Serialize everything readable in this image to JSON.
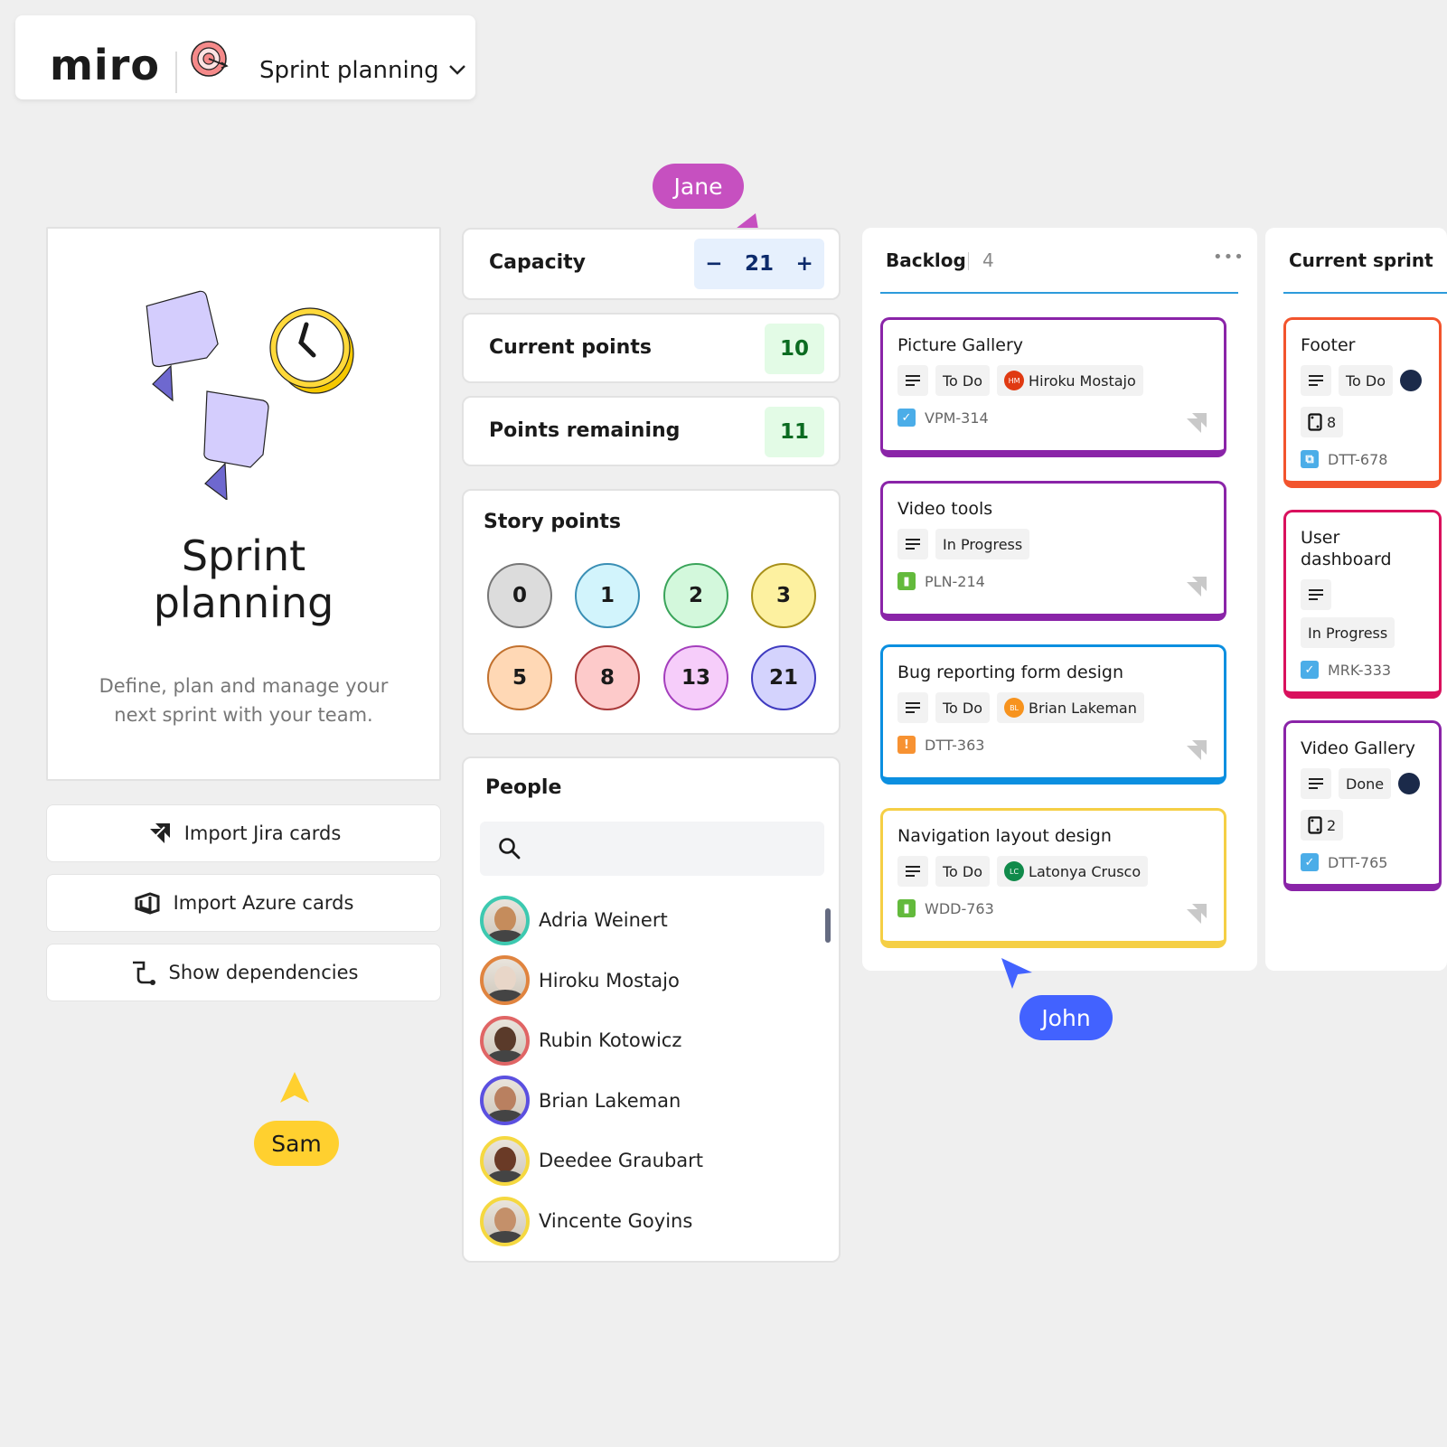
{
  "header": {
    "logo": "miro",
    "board_name": "Sprint planning",
    "board_icon": "target-icon",
    "dropdown_icon": "chevron-down-icon"
  },
  "cursors": [
    {
      "name": "Jane",
      "color": "#c650c0"
    },
    {
      "name": "Sam",
      "color": "#ffd02f"
    },
    {
      "name": "John",
      "color": "#4262ff"
    }
  ],
  "intro": {
    "title_line1": "Sprint",
    "title_line2": "planning",
    "desc_line1": "Define, plan and manage your",
    "desc_line2": "next sprint with your team."
  },
  "actions": [
    {
      "label": "Import Jira cards",
      "icon": "jira-icon"
    },
    {
      "label": "Import Azure cards",
      "icon": "azure-icon"
    },
    {
      "label": "Show dependencies",
      "icon": "dependencies-icon"
    }
  ],
  "capacity": {
    "label": "Capacity",
    "value": "21",
    "minus": "−",
    "plus": "+"
  },
  "current_points": {
    "label": "Current points",
    "value": "10"
  },
  "points_remaining": {
    "label": "Points remaining",
    "value": "11"
  },
  "story_points": {
    "title": "Story points",
    "values": [
      {
        "v": "0",
        "bg": "#dcdcdc",
        "border": "#777777"
      },
      {
        "v": "1",
        "bg": "#d2f4fc",
        "border": "#3a8fb5"
      },
      {
        "v": "2",
        "bg": "#d3f8dc",
        "border": "#3aa45a"
      },
      {
        "v": "3",
        "bg": "#fdf1a0",
        "border": "#a8901a"
      },
      {
        "v": "5",
        "bg": "#ffd8b5",
        "border": "#c2712e"
      },
      {
        "v": "8",
        "bg": "#fdcaca",
        "border": "#a93a3a"
      },
      {
        "v": "13",
        "bg": "#f6cdfa",
        "border": "#a43ebd"
      },
      {
        "v": "21",
        "bg": "#d4d3fd",
        "border": "#3f3bc0"
      }
    ]
  },
  "people": {
    "title": "People",
    "search_placeholder": "",
    "list": [
      {
        "name": "Adria Weinert",
        "ring": "#3dc9b0",
        "skin": "#c58c5c"
      },
      {
        "name": "Hiroku Mostajo",
        "ring": "#e0843f",
        "skin": "#e8d6c8"
      },
      {
        "name": "Rubin Kotowicz",
        "ring": "#e06565",
        "skin": "#5a3a2a"
      },
      {
        "name": "Brian Lakeman",
        "ring": "#5b50e0",
        "skin": "#b98060"
      },
      {
        "name": "Deedee Graubart",
        "ring": "#f5d840",
        "skin": "#6a3a26"
      },
      {
        "name": "Vincente Goyins",
        "ring": "#f5d840",
        "skin": "#c4906a"
      }
    ]
  },
  "backlog": {
    "title": "Backlog",
    "count": "4",
    "cards": [
      {
        "title": "Picture Gallery",
        "status": "To Do",
        "assignee": "Hiroku Mostajo",
        "initials": "HM",
        "avatar_color": "#e03a12",
        "id": "VPM-314",
        "type": "task",
        "border": "#8a24a8"
      },
      {
        "title": "Video tools",
        "status": "In Progress",
        "id": "PLN-214",
        "type": "story",
        "border": "#8a24a8"
      },
      {
        "title": "Bug reporting form design",
        "status": "To Do",
        "assignee": "Brian Lakeman",
        "initials": "BL",
        "avatar_color": "#f7931e",
        "id": "DTT-363",
        "type": "bug",
        "border": "#0b8fe0"
      },
      {
        "title": "Navigation layout design",
        "status": "To Do",
        "assignee": "Latonya Crusco",
        "initials": "LC",
        "avatar_color": "#108a4a",
        "id": "WDD-763",
        "type": "story",
        "border": "#f5cf45"
      }
    ]
  },
  "current_sprint": {
    "title": "Current sprint",
    "cards": [
      {
        "title": "Footer",
        "status": "To Do",
        "points": "8",
        "id": "DTT-678",
        "type": "subtask",
        "border": "#f2542d",
        "avatar_color": "#1b2a4a"
      },
      {
        "title": "User dashboard",
        "status": "In Progress",
        "id": "MRK-333",
        "type": "task",
        "border": "#d9115d"
      },
      {
        "title": "Video Gallery",
        "status": "Done",
        "points": "2",
        "id": "DTT-765",
        "type": "task",
        "border": "#8a24a8",
        "avatar_color": "#1b2a4a"
      }
    ]
  }
}
